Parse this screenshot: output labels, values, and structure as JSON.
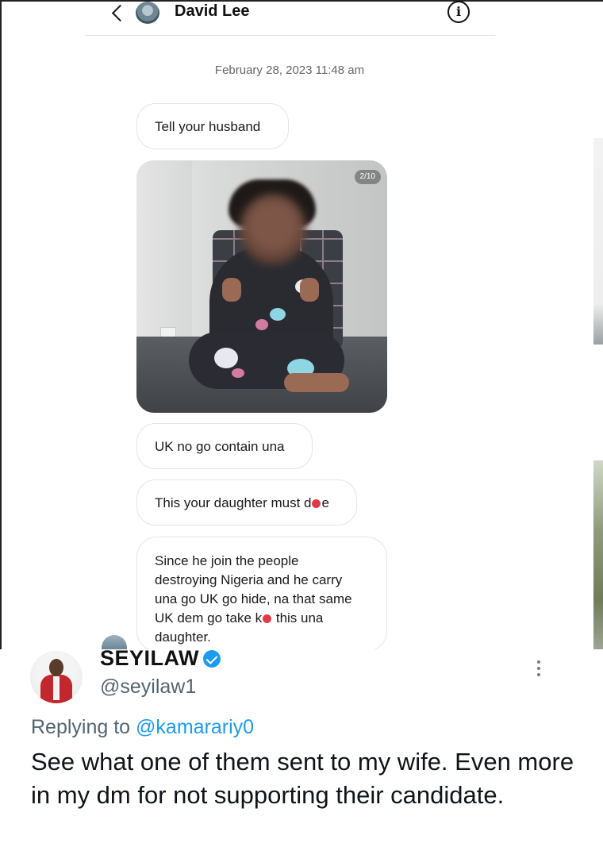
{
  "dm": {
    "contact_name": "David Lee",
    "timestamp": "February 28, 2023 11:48 am",
    "messages": [
      {
        "type": "text",
        "text": "Tell your husband"
      },
      {
        "type": "image",
        "counter": "2/10"
      },
      {
        "type": "text",
        "text": "UK no go contain una"
      },
      {
        "type": "text",
        "text_before": "This your daughter must d",
        "text_after": "e"
      },
      {
        "type": "text",
        "lines": [
          "Since he join the people",
          "destroying Nigeria and he carry",
          "una go UK go hide, na that same",
          "UK dem go take k",
          " this una",
          "daughter."
        ]
      }
    ]
  },
  "tweet": {
    "author_name": "SEYILAW",
    "handle": "@seyilaw1",
    "replying_prefix": "Replying to ",
    "replying_mention": "@kamarariy0",
    "text": "See what one of them sent to my wife. Even more in my dm for not supporting their candidate."
  },
  "icons": {
    "back": "chevron-left-icon",
    "info": "info-icon",
    "verified": "verified-badge-icon",
    "more": "more-vertical-icon"
  },
  "colors": {
    "link": "#1d9bf0",
    "verified": "#1d9bf0",
    "redaction": "#e0394a",
    "secondary_text": "#536471"
  }
}
